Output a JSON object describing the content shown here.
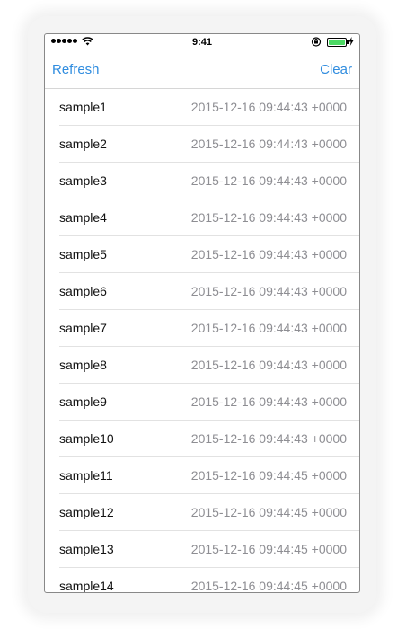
{
  "status_bar": {
    "time": "9:41",
    "signal_icon": "signal-dots-icon",
    "wifi_icon": "wifi-icon",
    "battery_color": "#4cd964"
  },
  "nav_bar": {
    "left_button": "Refresh",
    "right_button": "Clear",
    "tint_color": "#2f8cdf"
  },
  "list": {
    "items": [
      {
        "title": "sample1",
        "date": "2015-12-16 09:44:43 +0000"
      },
      {
        "title": "sample2",
        "date": "2015-12-16 09:44:43 +0000"
      },
      {
        "title": "sample3",
        "date": "2015-12-16 09:44:43 +0000"
      },
      {
        "title": "sample4",
        "date": "2015-12-16 09:44:43 +0000"
      },
      {
        "title": "sample5",
        "date": "2015-12-16 09:44:43 +0000"
      },
      {
        "title": "sample6",
        "date": "2015-12-16 09:44:43 +0000"
      },
      {
        "title": "sample7",
        "date": "2015-12-16 09:44:43 +0000"
      },
      {
        "title": "sample8",
        "date": "2015-12-16 09:44:43 +0000"
      },
      {
        "title": "sample9",
        "date": "2015-12-16 09:44:43 +0000"
      },
      {
        "title": "sample10",
        "date": "2015-12-16 09:44:43 +0000"
      },
      {
        "title": "sample11",
        "date": "2015-12-16 09:44:45 +0000"
      },
      {
        "title": "sample12",
        "date": "2015-12-16 09:44:45 +0000"
      },
      {
        "title": "sample13",
        "date": "2015-12-16 09:44:45 +0000"
      },
      {
        "title": "sample14",
        "date": "2015-12-16 09:44:45 +0000"
      }
    ]
  }
}
